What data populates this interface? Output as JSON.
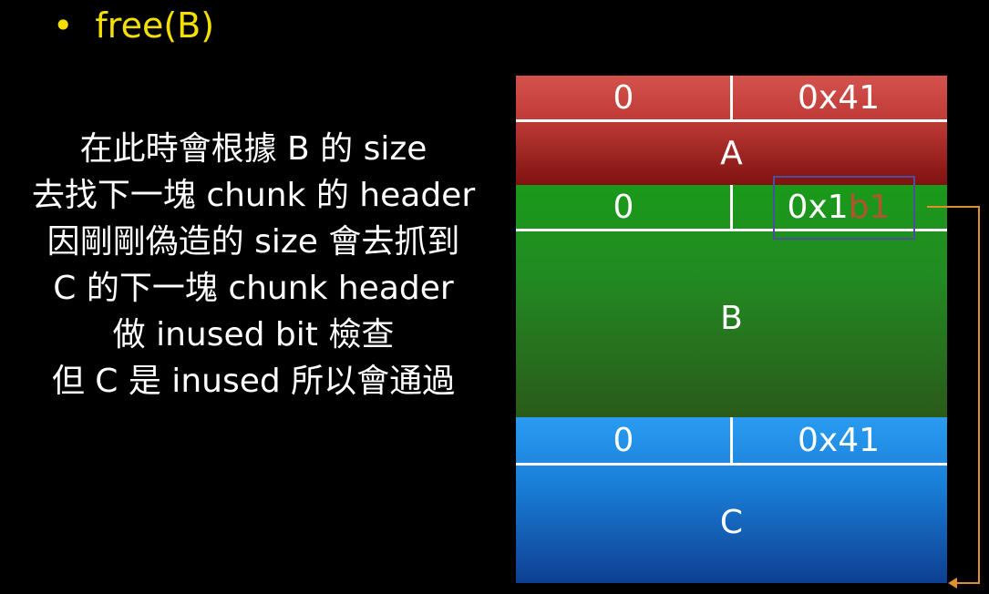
{
  "bullet": {
    "text": "free(B)"
  },
  "explanation": [
    "在此時會根據 B 的 size",
    "去找下一塊 chunk 的 header",
    "因剛剛偽造的 size 會去抓到",
    "C 的下一塊 chunk header",
    "做 inused bit 檢查",
    "但 C 是 inused 所以會通過"
  ],
  "chunks": {
    "a": {
      "prev_size": "0",
      "size": "0x41",
      "label": "A",
      "color": "#c0413c"
    },
    "b": {
      "prev_size": "0",
      "size_prefix": "0x1",
      "size_highlight": "b1",
      "label": "B",
      "color": "#1f8f1f"
    },
    "c": {
      "prev_size": "0",
      "size": "0x41",
      "label": "C",
      "color": "#1e8fe8"
    }
  },
  "colors": {
    "bullet": "#f4e000",
    "arrow": "#e0902a",
    "highlight_text": "#b2552e",
    "highlight_box": "#4a4fa0"
  }
}
